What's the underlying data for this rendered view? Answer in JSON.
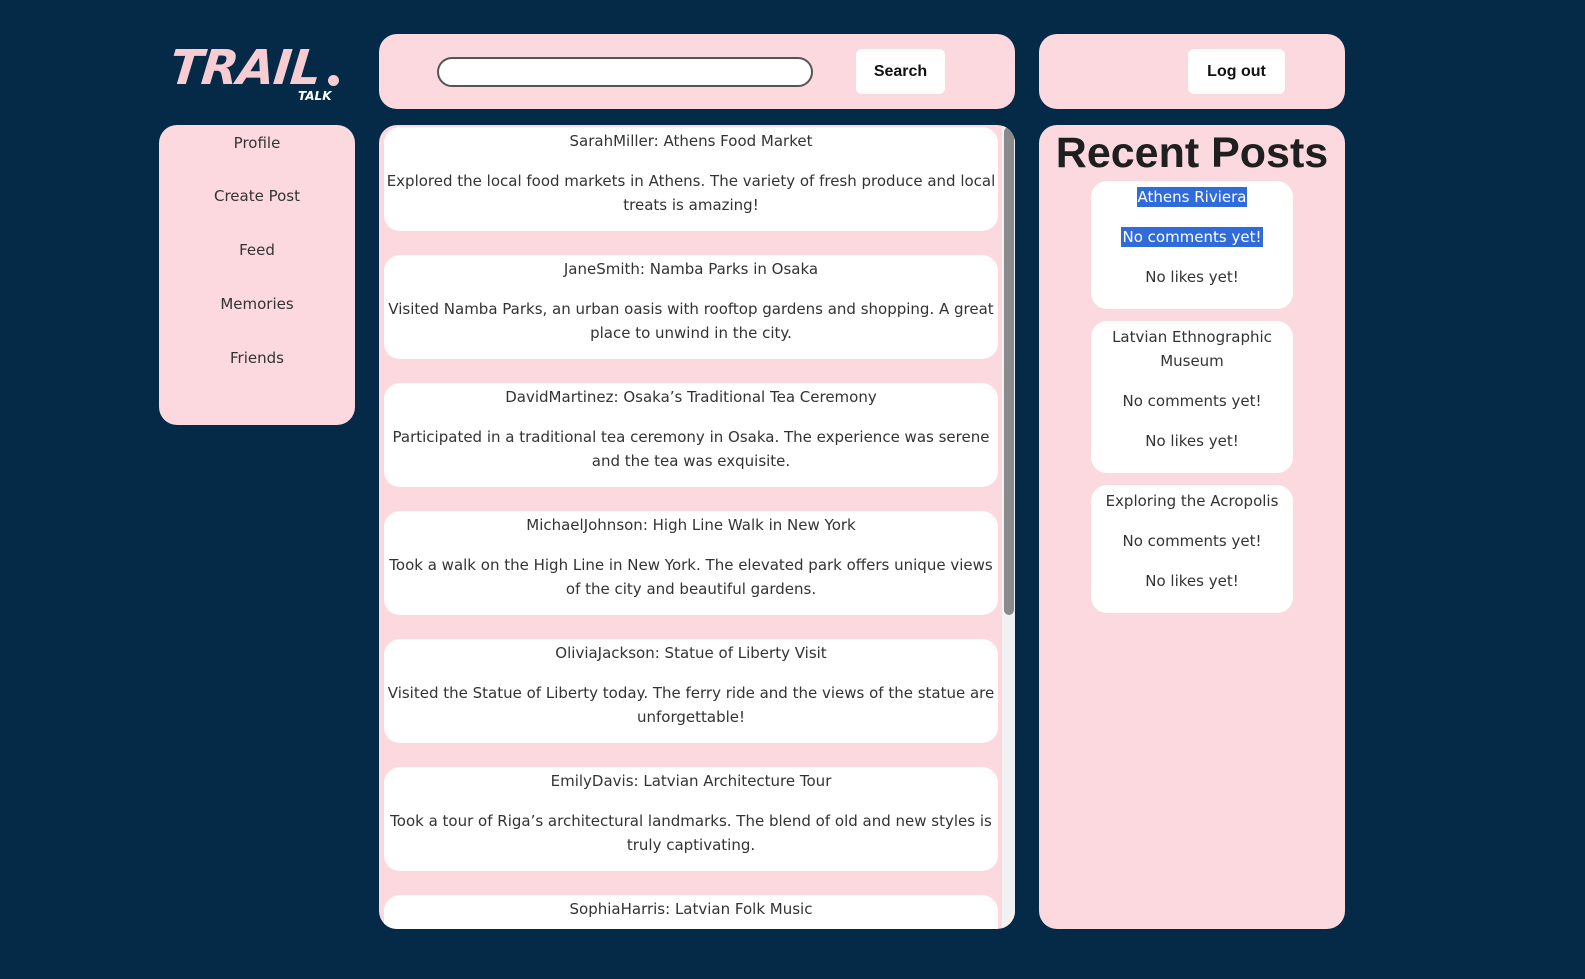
{
  "logo": {
    "main": "TRAIL",
    "sub": "TALK"
  },
  "header": {
    "search_placeholder": "",
    "search_label": "Search",
    "logout_label": "Log out"
  },
  "nav": {
    "items": [
      {
        "label": "Profile"
      },
      {
        "label": "Create Post"
      },
      {
        "label": "Feed"
      },
      {
        "label": "Memories"
      },
      {
        "label": "Friends"
      }
    ]
  },
  "feed": {
    "posts": [
      {
        "title": "SarahMiller: Athens Food Market",
        "body": "Explored the local food markets in Athens. The variety of fresh produce and local treats is amazing!"
      },
      {
        "title": "JaneSmith: Namba Parks in Osaka",
        "body": "Visited Namba Parks, an urban oasis with rooftop gardens and shopping. A great place to unwind in the city."
      },
      {
        "title": "DavidMartinez: Osaka’s Traditional Tea Ceremony",
        "body": "Participated in a traditional tea ceremony in Osaka. The experience was serene and the tea was exquisite."
      },
      {
        "title": "MichaelJohnson: High Line Walk in New York",
        "body": "Took a walk on the High Line in New York. The elevated park offers unique views of the city and beautiful gardens."
      },
      {
        "title": "OliviaJackson: Statue of Liberty Visit",
        "body": "Visited the Statue of Liberty today. The ferry ride and the views of the statue are unforgettable!"
      },
      {
        "title": "EmilyDavis: Latvian Architecture Tour",
        "body": "Took a tour of Riga’s architectural landmarks. The blend of old and new styles is truly captivating."
      },
      {
        "title": "SophiaHarris: Latvian Folk Music",
        "body": ""
      }
    ]
  },
  "recent": {
    "heading": "Recent Posts",
    "cards": [
      {
        "title": "Athens Riviera",
        "comments": "No comments yet!",
        "likes": "No likes yet!"
      },
      {
        "title": "Latvian Ethnographic Museum",
        "comments": "No comments yet!",
        "likes": "No likes yet!"
      },
      {
        "title": "Exploring the Acropolis",
        "comments": "No comments yet!",
        "likes": "No likes yet!"
      }
    ]
  },
  "colors": {
    "background": "#042a47",
    "panel": "#fbd9de",
    "selection": "#2f6bd9"
  }
}
